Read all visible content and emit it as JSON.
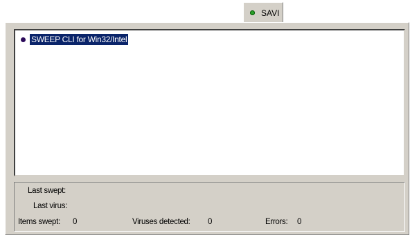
{
  "tab": {
    "label": "SAVI",
    "status_color": "#2aa02a"
  },
  "list": {
    "items": [
      {
        "label": "SWEEP CLI for Win32/Intel",
        "selected": true
      }
    ]
  },
  "stats": {
    "last_swept_label": "Last swept:",
    "last_swept_value": "",
    "last_virus_label": "Last virus:",
    "last_virus_value": "",
    "items_swept_label": "Items swept:",
    "items_swept_value": "0",
    "viruses_detected_label": "Viruses detected:",
    "viruses_detected_value": "0",
    "errors_label": "Errors:",
    "errors_value": "0"
  }
}
